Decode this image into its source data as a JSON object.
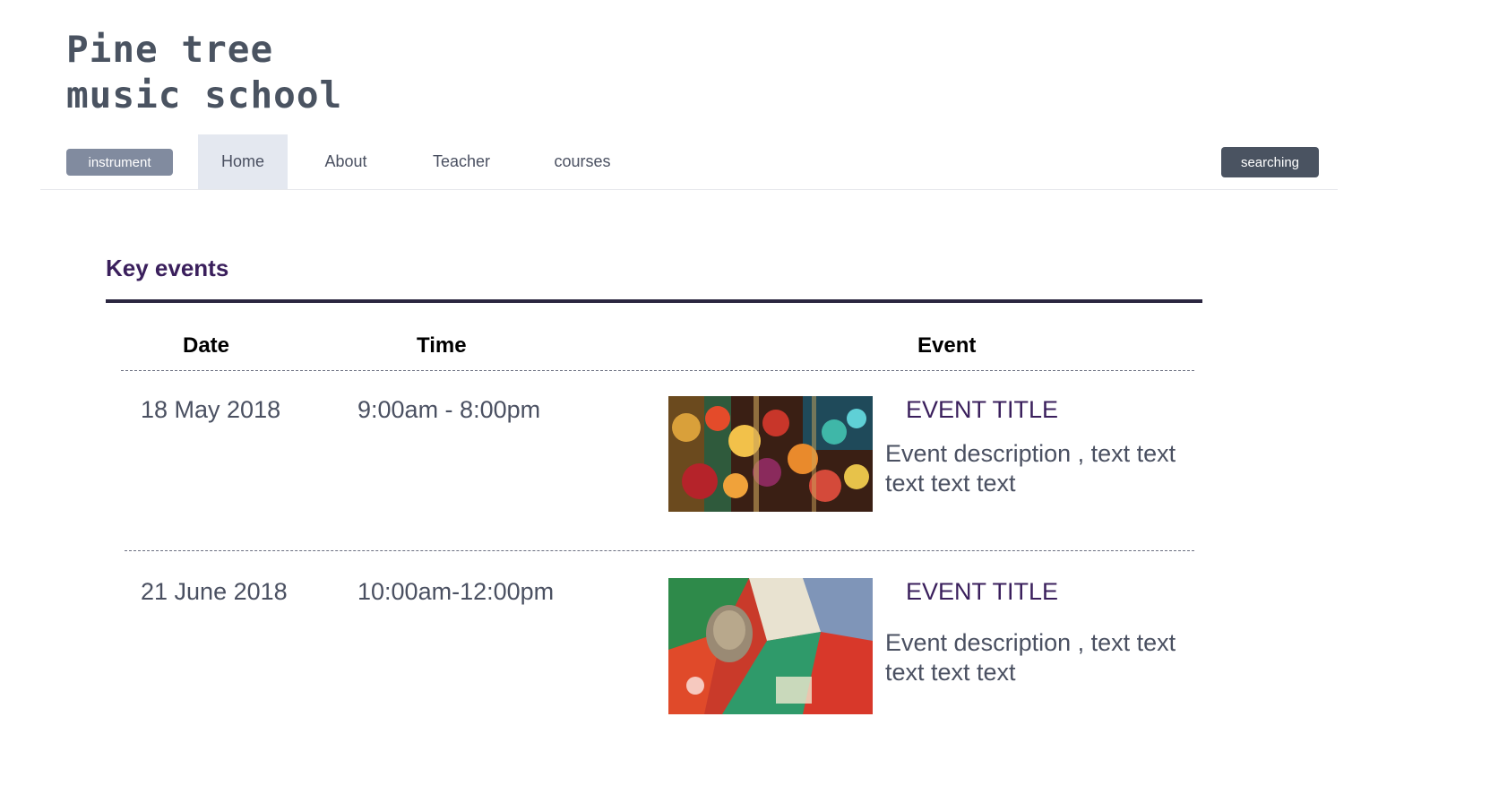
{
  "logo": {
    "line1": "Pine tree",
    "line2": "music school"
  },
  "nav": {
    "instrument_label": "instrument",
    "items": [
      {
        "label": "Home",
        "active": true
      },
      {
        "label": "About"
      },
      {
        "label": "Teacher"
      },
      {
        "label": "courses"
      }
    ],
    "search_label": "searching"
  },
  "events_section": {
    "title": "Key events",
    "headers": {
      "date": "Date",
      "time": "Time",
      "event": "Event"
    },
    "rows": [
      {
        "date": "18 May 2018",
        "time": "9:00am - 8:00pm",
        "title": "EVENT TITLE",
        "description": "Event description , text text text text text",
        "image": "colorful-lanterns-photo"
      },
      {
        "date": "21 June 2018",
        "time": "10:00am-12:00pm",
        "title": "EVENT TITLE",
        "description": "Event description , text text text text text",
        "image": "masked-performer-colorful-cloth-photo"
      }
    ]
  },
  "colors": {
    "logo_text": "#4a5361",
    "instrument_button": "#818b9f",
    "search_button": "#4a5361",
    "nav_active_bg": "#e4e8f0",
    "section_title": "#3a1f5c",
    "event_title": "#3a1f5c",
    "rule": "#2b2640"
  }
}
